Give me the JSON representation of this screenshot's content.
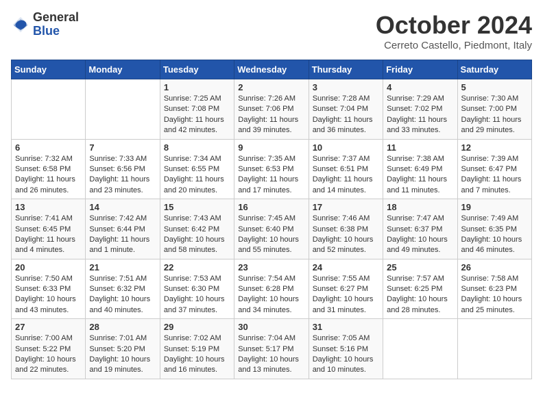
{
  "header": {
    "logo_general": "General",
    "logo_blue": "Blue",
    "month_title": "October 2024",
    "location": "Cerreto Castello, Piedmont, Italy"
  },
  "days_of_week": [
    "Sunday",
    "Monday",
    "Tuesday",
    "Wednesday",
    "Thursday",
    "Friday",
    "Saturday"
  ],
  "weeks": [
    [
      {
        "day": "",
        "info": ""
      },
      {
        "day": "",
        "info": ""
      },
      {
        "day": "1",
        "info": "Sunrise: 7:25 AM\nSunset: 7:08 PM\nDaylight: 11 hours and 42 minutes."
      },
      {
        "day": "2",
        "info": "Sunrise: 7:26 AM\nSunset: 7:06 PM\nDaylight: 11 hours and 39 minutes."
      },
      {
        "day": "3",
        "info": "Sunrise: 7:28 AM\nSunset: 7:04 PM\nDaylight: 11 hours and 36 minutes."
      },
      {
        "day": "4",
        "info": "Sunrise: 7:29 AM\nSunset: 7:02 PM\nDaylight: 11 hours and 33 minutes."
      },
      {
        "day": "5",
        "info": "Sunrise: 7:30 AM\nSunset: 7:00 PM\nDaylight: 11 hours and 29 minutes."
      }
    ],
    [
      {
        "day": "6",
        "info": "Sunrise: 7:32 AM\nSunset: 6:58 PM\nDaylight: 11 hours and 26 minutes."
      },
      {
        "day": "7",
        "info": "Sunrise: 7:33 AM\nSunset: 6:56 PM\nDaylight: 11 hours and 23 minutes."
      },
      {
        "day": "8",
        "info": "Sunrise: 7:34 AM\nSunset: 6:55 PM\nDaylight: 11 hours and 20 minutes."
      },
      {
        "day": "9",
        "info": "Sunrise: 7:35 AM\nSunset: 6:53 PM\nDaylight: 11 hours and 17 minutes."
      },
      {
        "day": "10",
        "info": "Sunrise: 7:37 AM\nSunset: 6:51 PM\nDaylight: 11 hours and 14 minutes."
      },
      {
        "day": "11",
        "info": "Sunrise: 7:38 AM\nSunset: 6:49 PM\nDaylight: 11 hours and 11 minutes."
      },
      {
        "day": "12",
        "info": "Sunrise: 7:39 AM\nSunset: 6:47 PM\nDaylight: 11 hours and 7 minutes."
      }
    ],
    [
      {
        "day": "13",
        "info": "Sunrise: 7:41 AM\nSunset: 6:45 PM\nDaylight: 11 hours and 4 minutes."
      },
      {
        "day": "14",
        "info": "Sunrise: 7:42 AM\nSunset: 6:44 PM\nDaylight: 11 hours and 1 minute."
      },
      {
        "day": "15",
        "info": "Sunrise: 7:43 AM\nSunset: 6:42 PM\nDaylight: 10 hours and 58 minutes."
      },
      {
        "day": "16",
        "info": "Sunrise: 7:45 AM\nSunset: 6:40 PM\nDaylight: 10 hours and 55 minutes."
      },
      {
        "day": "17",
        "info": "Sunrise: 7:46 AM\nSunset: 6:38 PM\nDaylight: 10 hours and 52 minutes."
      },
      {
        "day": "18",
        "info": "Sunrise: 7:47 AM\nSunset: 6:37 PM\nDaylight: 10 hours and 49 minutes."
      },
      {
        "day": "19",
        "info": "Sunrise: 7:49 AM\nSunset: 6:35 PM\nDaylight: 10 hours and 46 minutes."
      }
    ],
    [
      {
        "day": "20",
        "info": "Sunrise: 7:50 AM\nSunset: 6:33 PM\nDaylight: 10 hours and 43 minutes."
      },
      {
        "day": "21",
        "info": "Sunrise: 7:51 AM\nSunset: 6:32 PM\nDaylight: 10 hours and 40 minutes."
      },
      {
        "day": "22",
        "info": "Sunrise: 7:53 AM\nSunset: 6:30 PM\nDaylight: 10 hours and 37 minutes."
      },
      {
        "day": "23",
        "info": "Sunrise: 7:54 AM\nSunset: 6:28 PM\nDaylight: 10 hours and 34 minutes."
      },
      {
        "day": "24",
        "info": "Sunrise: 7:55 AM\nSunset: 6:27 PM\nDaylight: 10 hours and 31 minutes."
      },
      {
        "day": "25",
        "info": "Sunrise: 7:57 AM\nSunset: 6:25 PM\nDaylight: 10 hours and 28 minutes."
      },
      {
        "day": "26",
        "info": "Sunrise: 7:58 AM\nSunset: 6:23 PM\nDaylight: 10 hours and 25 minutes."
      }
    ],
    [
      {
        "day": "27",
        "info": "Sunrise: 7:00 AM\nSunset: 5:22 PM\nDaylight: 10 hours and 22 minutes."
      },
      {
        "day": "28",
        "info": "Sunrise: 7:01 AM\nSunset: 5:20 PM\nDaylight: 10 hours and 19 minutes."
      },
      {
        "day": "29",
        "info": "Sunrise: 7:02 AM\nSunset: 5:19 PM\nDaylight: 10 hours and 16 minutes."
      },
      {
        "day": "30",
        "info": "Sunrise: 7:04 AM\nSunset: 5:17 PM\nDaylight: 10 hours and 13 minutes."
      },
      {
        "day": "31",
        "info": "Sunrise: 7:05 AM\nSunset: 5:16 PM\nDaylight: 10 hours and 10 minutes."
      },
      {
        "day": "",
        "info": ""
      },
      {
        "day": "",
        "info": ""
      }
    ]
  ]
}
